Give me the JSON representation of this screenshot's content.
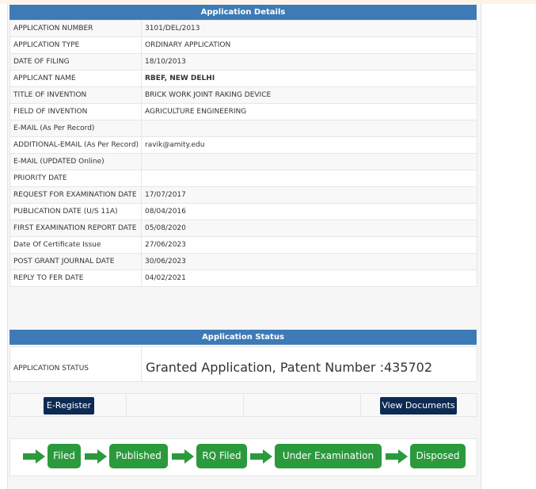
{
  "details": {
    "heading": "Application Details",
    "rows": [
      {
        "label": "APPLICATION NUMBER",
        "value": "3101/DEL/2013"
      },
      {
        "label": "APPLICATION TYPE",
        "value": "ORDINARY APPLICATION"
      },
      {
        "label": "DATE OF FILING",
        "value": "18/10/2013"
      },
      {
        "label": "APPLICANT NAME",
        "value": "RBEF, NEW DELHI"
      },
      {
        "label": "TITLE OF INVENTION",
        "value": "BRICK WORK JOINT RAKING DEVICE"
      },
      {
        "label": "FIELD OF INVENTION",
        "value": "AGRICULTURE ENGINEERING"
      },
      {
        "label": "E-MAIL (As Per Record)",
        "value": ""
      },
      {
        "label": "ADDITIONAL-EMAIL (As Per Record)",
        "value": "ravik@amity.edu"
      },
      {
        "label": "E-MAIL (UPDATED Online)",
        "value": ""
      },
      {
        "label": "PRIORITY DATE",
        "value": ""
      },
      {
        "label": "REQUEST FOR EXAMINATION DATE",
        "value": "17/07/2017"
      },
      {
        "label": "PUBLICATION DATE (U/S 11A)",
        "value": "08/04/2016"
      },
      {
        "label": "FIRST EXAMINATION REPORT DATE",
        "value": "05/08/2020"
      },
      {
        "label": "Date Of Certificate Issue",
        "value": "27/06/2023"
      },
      {
        "label": "POST GRANT JOURNAL DATE",
        "value": "30/06/2023"
      },
      {
        "label": "REPLY TO FER DATE",
        "value": "04/02/2021"
      }
    ]
  },
  "status": {
    "heading": "Application Status",
    "label": "APPLICATION STATUS",
    "value": "Granted Application, Patent Number :435702"
  },
  "actions": {
    "eregister": "E-Register",
    "view_documents": "View Documents"
  },
  "flow": {
    "stages": [
      "Filed",
      "Published",
      "RQ Filed",
      "Under Examination",
      "Disposed"
    ]
  },
  "colors": {
    "header_blue": "#3e7bb6",
    "button_navy": "#0d2b52",
    "stage_green": "#2a9a3c"
  }
}
